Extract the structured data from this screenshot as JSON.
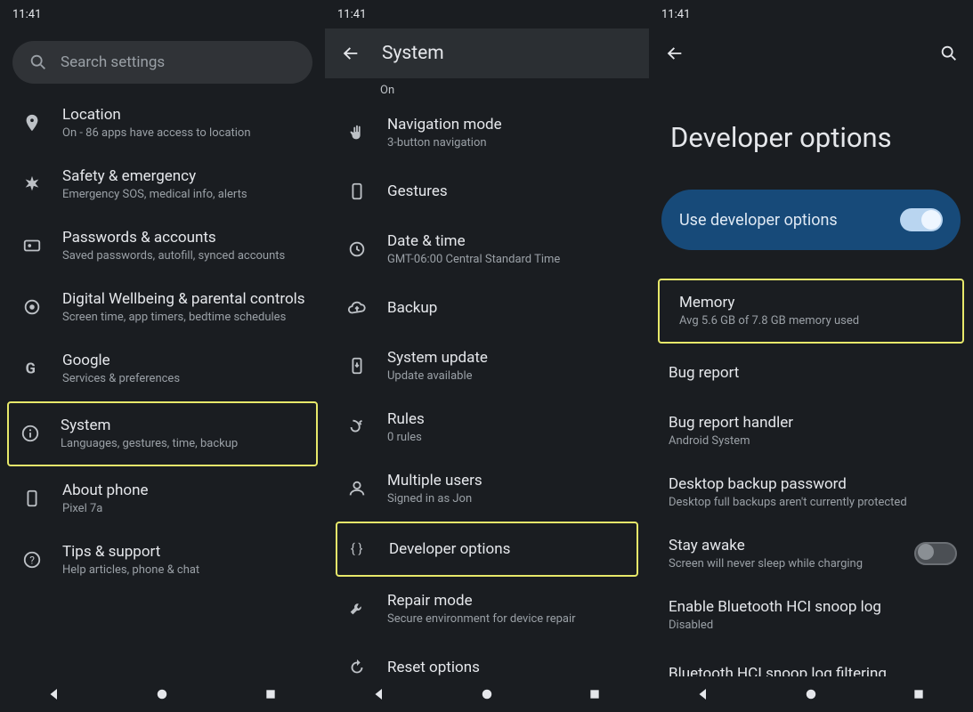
{
  "status": {
    "time": "11:41"
  },
  "screen1": {
    "search_placeholder": "Search settings",
    "items": [
      {
        "title": "Location",
        "sub": "On - 86 apps have access to location"
      },
      {
        "title": "Safety & emergency",
        "sub": "Emergency SOS, medical info, alerts"
      },
      {
        "title": "Passwords & accounts",
        "sub": "Saved passwords, autofill, synced accounts"
      },
      {
        "title": "Digital Wellbeing & parental controls",
        "sub": "Screen time, app timers, bedtime schedules"
      },
      {
        "title": "Google",
        "sub": "Services & preferences"
      },
      {
        "title": "System",
        "sub": "Languages, gestures, time, backup"
      },
      {
        "title": "About phone",
        "sub": "Pixel 7a"
      },
      {
        "title": "Tips & support",
        "sub": "Help articles, phone & chat"
      }
    ]
  },
  "screen2": {
    "title": "System",
    "onLabel": "On",
    "items": [
      {
        "title": "Navigation mode",
        "sub": "3-button navigation"
      },
      {
        "title": "Gestures",
        "sub": ""
      },
      {
        "title": "Date & time",
        "sub": "GMT-06:00 Central Standard Time"
      },
      {
        "title": "Backup",
        "sub": ""
      },
      {
        "title": "System update",
        "sub": "Update available"
      },
      {
        "title": "Rules",
        "sub": "0 rules"
      },
      {
        "title": "Multiple users",
        "sub": "Signed in as Jon"
      },
      {
        "title": "Developer options",
        "sub": ""
      },
      {
        "title": "Repair mode",
        "sub": "Secure environment for device repair"
      },
      {
        "title": "Reset options",
        "sub": ""
      }
    ]
  },
  "screen3": {
    "title": "Developer options",
    "toggle_label": "Use developer options",
    "items": [
      {
        "title": "Memory",
        "sub": "Avg 5.6 GB of 7.8 GB memory used"
      },
      {
        "title": "Bug report",
        "sub": ""
      },
      {
        "title": "Bug report handler",
        "sub": "Android System"
      },
      {
        "title": "Desktop backup password",
        "sub": "Desktop full backups aren't currently protected"
      },
      {
        "title": "Stay awake",
        "sub": "Screen will never sleep while charging"
      },
      {
        "title": "Enable Bluetooth HCI snoop log",
        "sub": "Disabled"
      },
      {
        "title": "Bluetooth HCI snoop log filtering",
        "sub": ""
      }
    ]
  }
}
